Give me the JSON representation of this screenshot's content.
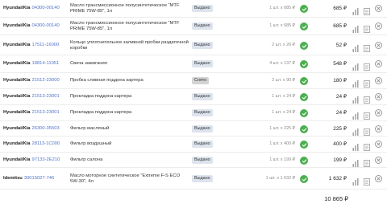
{
  "rows": [
    {
      "brand": "Hyundai/Kia",
      "code": "04300-00140",
      "desc": "Масло трансмиссионное полусинтетическое \"MTF PRIME 75W-85\", 1л",
      "status": "Выдано",
      "status_type": "issued",
      "qty": "1 шт. x 685 ₽",
      "total": "685 ₽"
    },
    {
      "brand": "Hyundai/Kia",
      "code": "04300-00140",
      "desc": "Масло трансмиссионное полусинтетическое \"MTF PRIME 75W-85\", 1л",
      "status": "Выдано",
      "status_type": "issued",
      "qty": "1 шт. x 685 ₽",
      "total": "685 ₽"
    },
    {
      "brand": "Hyundai/Kia",
      "code": "17511-16000",
      "desc": "Кольцо уплотнительное заливной пробки раздаточной коробки",
      "status": "Выдано",
      "status_type": "issued",
      "qty": "2 шт. x 26 ₽",
      "total": "52 ₽"
    },
    {
      "brand": "Hyundai/Kia",
      "code": "18814-11051",
      "desc": "Свеча зажигания",
      "status": "Выдано",
      "status_type": "issued",
      "qty": "4 шт. x 137 ₽",
      "total": "548 ₽"
    },
    {
      "brand": "Hyundai/Kia",
      "code": "21512-23000",
      "desc": "Пробка сливная поддона картера",
      "status": "Снято",
      "status_type": "cancel",
      "qty": "2 шт. x 90 ₽",
      "total": "180 ₽"
    },
    {
      "brand": "Hyundai/Kia",
      "code": "21513-23001",
      "desc": "Прокладка поддона картера",
      "status": "Выдано",
      "status_type": "issued",
      "qty": "1 шт. x 24 ₽",
      "total": "24 ₽"
    },
    {
      "brand": "Hyundai/Kia",
      "code": "21513-23001",
      "desc": "Прокладка поддона картера",
      "status": "Выдано",
      "status_type": "issued",
      "qty": "1 шт. x 24 ₽",
      "total": "24 ₽"
    },
    {
      "brand": "Hyundai/Kia",
      "code": "26300-35503",
      "desc": "Фильтр масляный",
      "status": "Выдано",
      "status_type": "issued",
      "qty": "1 шт. x 225 ₽",
      "total": "225 ₽"
    },
    {
      "brand": "Hyundai/Kia",
      "code": "28113-1C000",
      "desc": "Фильтр воздушный",
      "status": "Выдано",
      "status_type": "issued",
      "qty": "1 шт. x 400 ₽",
      "total": "400 ₽"
    },
    {
      "brand": "Hyundai/Kia",
      "code": "97133-2E210",
      "desc": "Фильтр салона",
      "status": "Выдано",
      "status_type": "issued",
      "qty": "1 шт. x 199 ₽",
      "total": "199 ₽"
    },
    {
      "brand": "Idemitsu",
      "code": "30015027-746",
      "desc": "Масло моторное синтетическое \"Extreme F-S ECO 5W-30\", 4л",
      "status": "Выдано",
      "status_type": "issued",
      "qty": "1 шт. x 1 632 ₽",
      "total": "1 632 ₽"
    }
  ],
  "grand_total": "10 865 ₽",
  "icons": {
    "check": "check-circle-icon",
    "stats": "bar-chart-icon",
    "doc": "document-icon",
    "delete": "close-circle-icon"
  },
  "colors": {
    "check": "#4caf50",
    "code_link": "#4f73c9",
    "status_issued_bg": "#dde4ee",
    "status_cancel_bg": "#d4d4d4"
  }
}
